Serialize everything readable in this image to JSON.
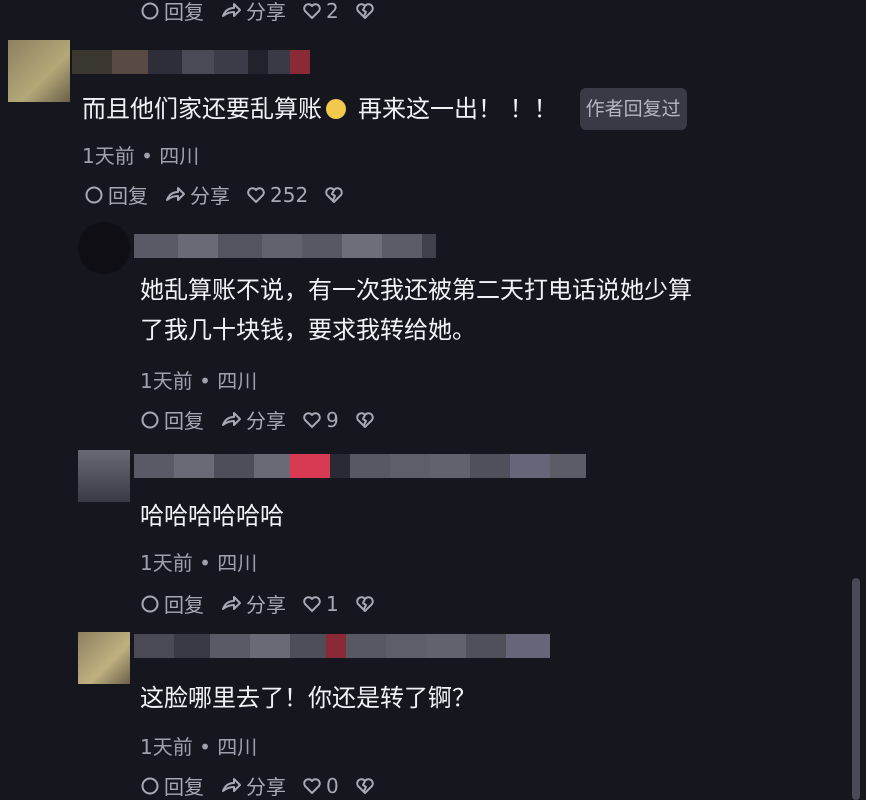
{
  "colors": {
    "background": "#16161f",
    "text": "#f2f2f6",
    "meta": "#a0a0ac",
    "tag_bg": "#3a3a46"
  },
  "actions": {
    "reply": "回复",
    "share": "分享"
  },
  "top_actions": {
    "likes": "2"
  },
  "comments": [
    {
      "text": "而且他们家还要乱算账",
      "emoji": "smirk-emoji",
      "text_after": "再来这一出！ ！！",
      "author_tag": "作者回复过",
      "time": "1天前",
      "location": "四川",
      "likes": "252"
    },
    {
      "text_line1": "她乱算账不说，有一次我还被第二天打电话说她少算",
      "text_line2": "了我几十块钱，要求我转给她。",
      "time": "1天前",
      "location": "四川",
      "likes": "9"
    },
    {
      "text": "哈哈哈哈哈哈",
      "time": "1天前",
      "location": "四川",
      "likes": "1"
    },
    {
      "text": "这脸哪里去了！你还是转了锕？",
      "time": "1天前",
      "location": "四川",
      "likes": "0"
    }
  ],
  "dot": "•"
}
